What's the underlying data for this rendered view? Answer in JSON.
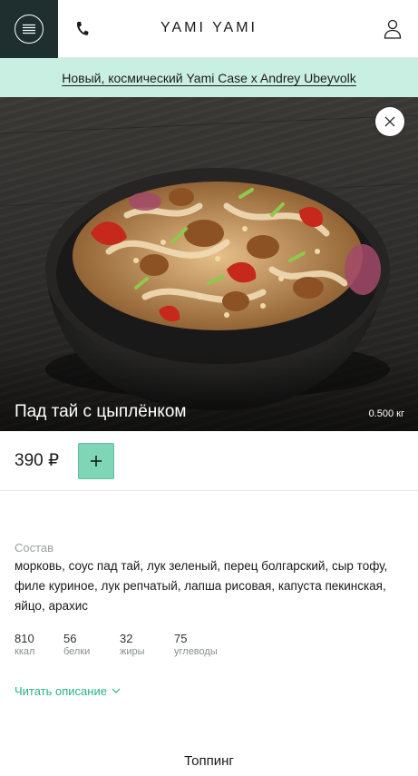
{
  "header": {
    "logo_text": "YAMI YAMI",
    "menu_icon": "menu-icon",
    "phone_icon": "phone-icon",
    "user_icon": "user-icon"
  },
  "promo": {
    "text": "Новый, космический Yami Case x Andrey Ubeyvolk"
  },
  "product": {
    "title": "Пад тай с цыплёнком",
    "weight": "0.500 кг",
    "price": "390 ₽",
    "add_icon": "plus-icon",
    "close_icon": "close-icon",
    "composition_label": "Состав",
    "composition": "морковь, соус пад тай, лук зеленый, перец болгарский, сыр тофу, филе куриное, лук репчатый, лапша рисовая, капуста пекинская, яйцо, арахис",
    "nutrients": [
      {
        "value": "810",
        "label": "ккал"
      },
      {
        "value": "56",
        "label": "белки"
      },
      {
        "value": "32",
        "label": "жиры"
      },
      {
        "value": "75",
        "label": "углеводы"
      }
    ],
    "read_more": "Читать описание",
    "topping_title": "Топпинг"
  },
  "colors": {
    "menu_bg": "#1f2f2f",
    "promo_bg": "#c9efe2",
    "accent": "#7fd6b6",
    "link": "#2bb285"
  }
}
